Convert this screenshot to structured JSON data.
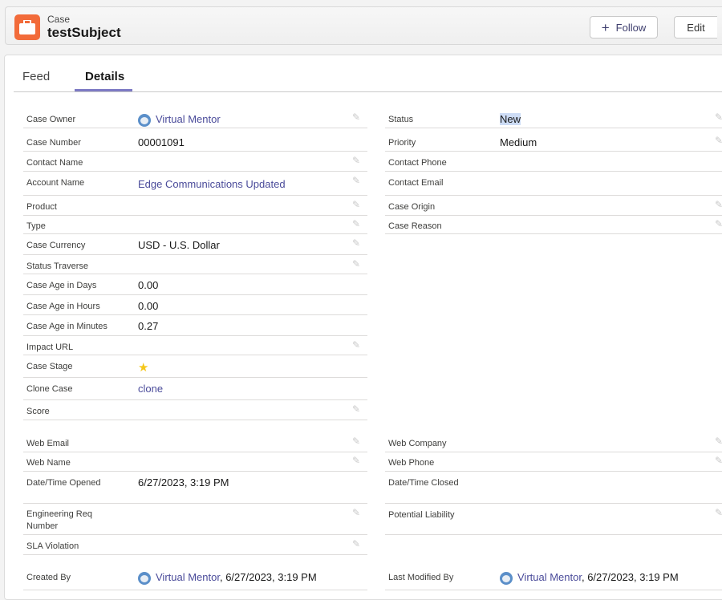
{
  "header": {
    "eyebrow": "Case",
    "title": "testSubject",
    "follow_label": "Follow",
    "edit_label": "Edit"
  },
  "tabs": {
    "feed": "Feed",
    "details": "Details"
  },
  "left_fields": [
    {
      "label": "Case Owner",
      "value": "Virtual Mentor"
    },
    {
      "label": "Case Number",
      "value": "00001091"
    },
    {
      "label": "Contact Name",
      "value": ""
    },
    {
      "label": "Account Name",
      "value": "Edge Communications Updated"
    },
    {
      "label": "Product",
      "value": ""
    },
    {
      "label": "Type",
      "value": ""
    },
    {
      "label": "Case Currency",
      "value": "USD - U.S. Dollar"
    },
    {
      "label": "Status Traverse",
      "value": ""
    },
    {
      "label": "Case Age in Days",
      "value": "0.00"
    },
    {
      "label": "Case Age in Hours",
      "value": "0.00"
    },
    {
      "label": "Case Age in Minutes",
      "value": "0.27"
    },
    {
      "label": "Impact URL",
      "value": ""
    },
    {
      "label": "Case Stage",
      "value": "star"
    },
    {
      "label": "Clone Case",
      "value": "clone"
    },
    {
      "label": "Score",
      "value": ""
    },
    {
      "label": "Web Email",
      "value": ""
    },
    {
      "label": "Web Name",
      "value": ""
    },
    {
      "label": "Date/Time Opened",
      "value": "6/27/2023, 3:19 PM"
    },
    {
      "label": "Engineering Req Number",
      "value": ""
    },
    {
      "label": "SLA Violation",
      "value": ""
    },
    {
      "label": "Created By",
      "value": "Virtual Mentor",
      "suffix": ", 6/27/2023, 3:19 PM"
    }
  ],
  "right_fields": [
    {
      "label": "Status",
      "value": "New"
    },
    {
      "label": "Priority",
      "value": "Medium"
    },
    {
      "label": "Contact Phone",
      "value": ""
    },
    {
      "label": "Contact Email",
      "value": ""
    },
    {
      "label": "Case Origin",
      "value": ""
    },
    {
      "label": "Case Reason",
      "value": ""
    },
    {
      "label": "Web Company",
      "value": ""
    },
    {
      "label": "Web Phone",
      "value": ""
    },
    {
      "label": "Date/Time Closed",
      "value": ""
    },
    {
      "label": "Potential Liability",
      "value": ""
    },
    {
      "label": "Last Modified By",
      "value": "Virtual Mentor",
      "suffix": ", 6/27/2023, 3:19 PM"
    }
  ],
  "colors": {
    "brand_orange": "#f26b3a",
    "link": "#4a4b9a",
    "tab_accent": "#7d7ac4"
  }
}
